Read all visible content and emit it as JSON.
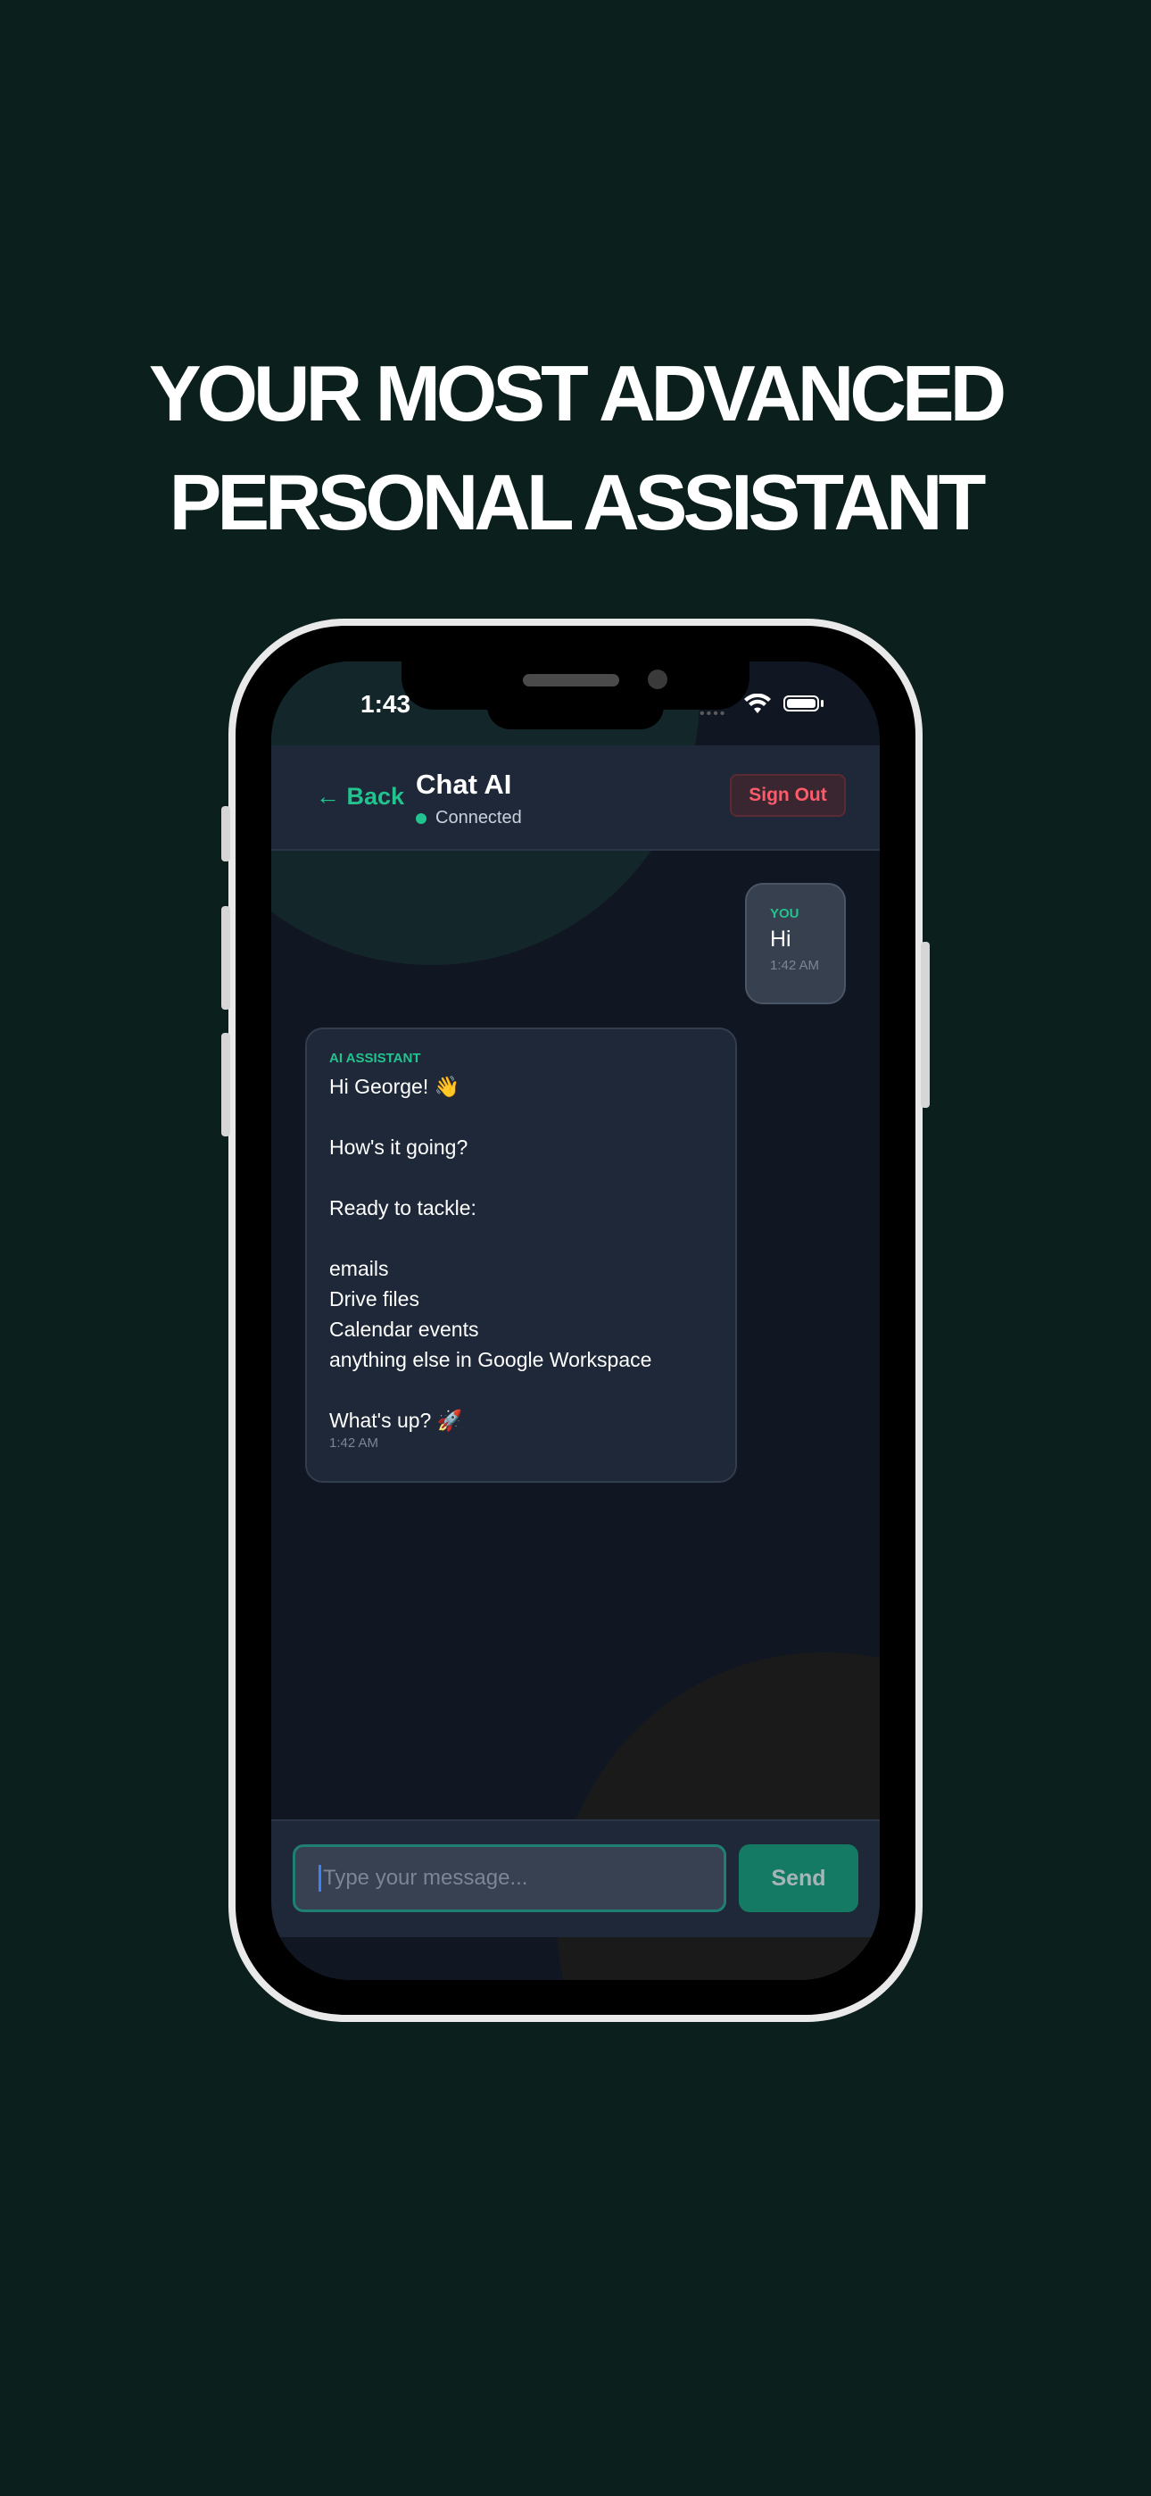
{
  "headline": {
    "line1": "YOUR MOST ADVANCED",
    "line2": "PERSONAL ASSISTANT"
  },
  "status_bar": {
    "time": "1:43"
  },
  "header": {
    "back_label": "← Back",
    "title": "Chat AI",
    "status": "Connected",
    "signout_label": "Sign Out"
  },
  "messages": {
    "user": {
      "sender": "YOU",
      "text": "Hi",
      "time": "1:42 AM"
    },
    "ai": {
      "sender": "AI ASSISTANT",
      "lines": [
        "Hi George! 👋",
        "",
        "How's it going?",
        "",
        "Ready to tackle:",
        "",
        "emails",
        "Drive files",
        "Calendar events",
        "anything else in Google Workspace",
        "",
        "What's up? 🚀"
      ],
      "time": "1:42 AM"
    }
  },
  "composer": {
    "placeholder": "Type your message...",
    "send_label": "Send"
  },
  "colors": {
    "background": "#0b201d",
    "accent": "#22c38e",
    "danger": "#ff5b6b",
    "send": "#147a64"
  },
  "icons": {
    "wifi": "wifi-icon",
    "battery": "battery-icon",
    "signal": "signal-icon",
    "back": "arrow-left-icon"
  }
}
